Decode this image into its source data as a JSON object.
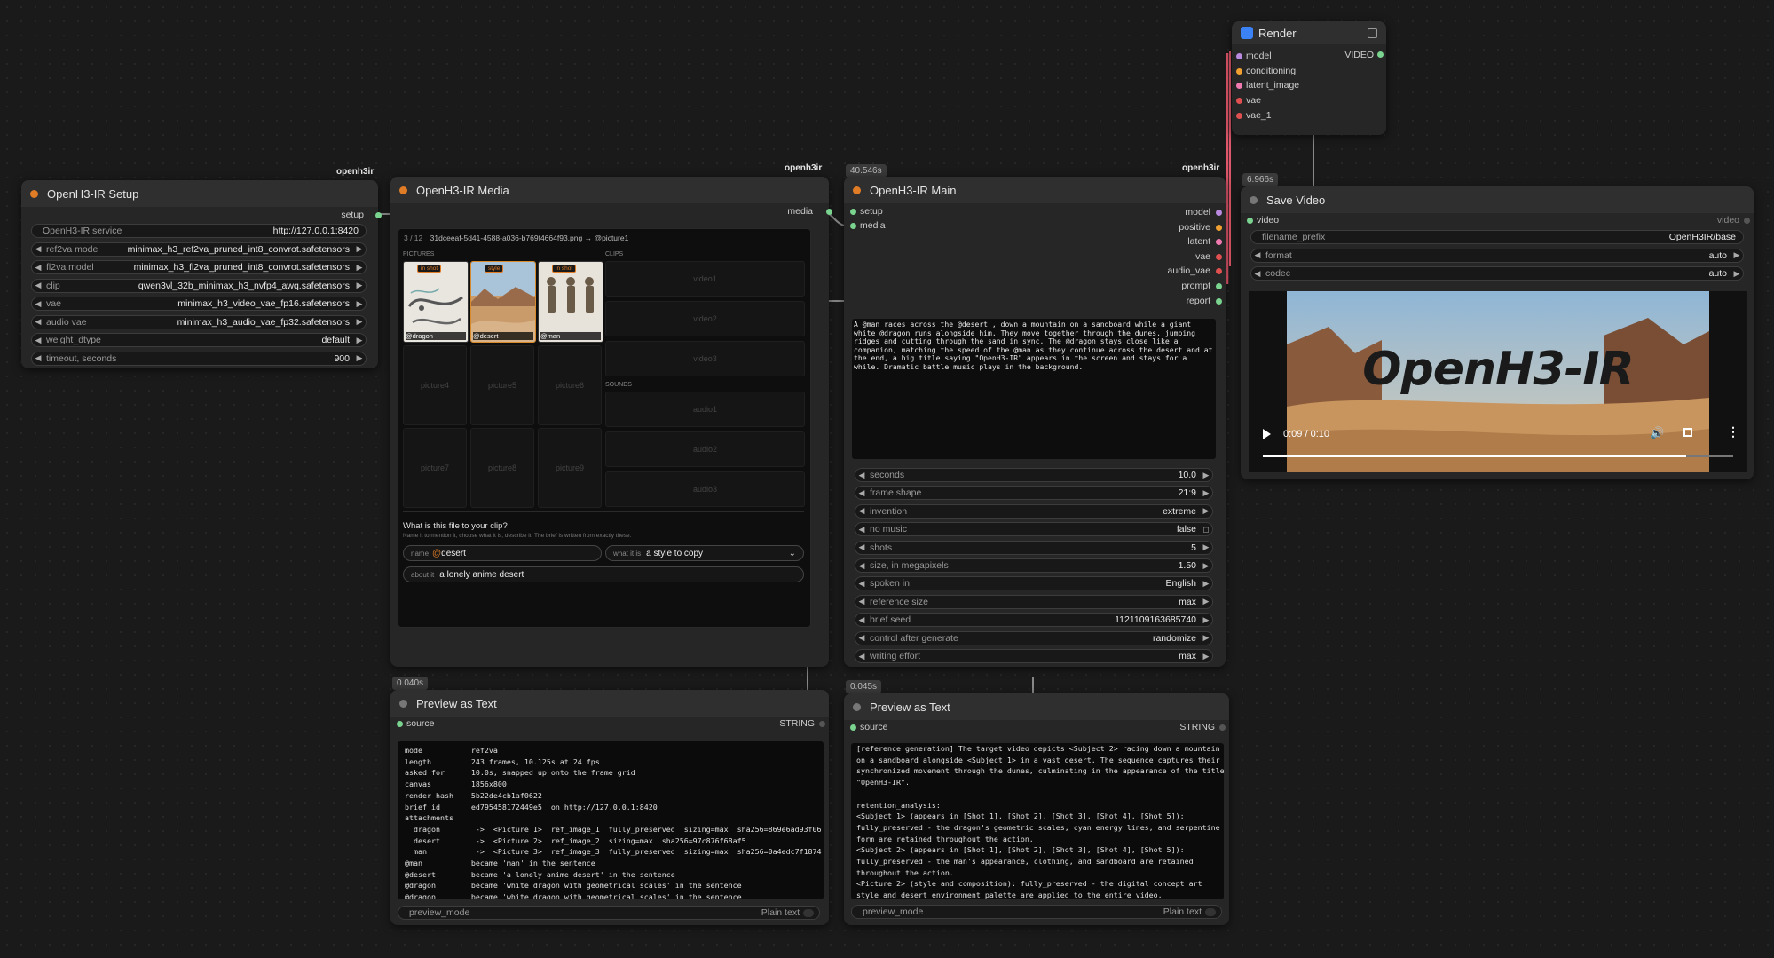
{
  "setup_node": {
    "tag": "openh3ir",
    "title": "OpenH3-IR Setup",
    "output": "setup",
    "widgets": [
      {
        "label": "OpenH3-IR service",
        "value": "http://127.0.0.1:8420"
      },
      {
        "label": "ref2va model",
        "value": "minimax_h3_ref2va_pruned_int8_convrot.safetensors"
      },
      {
        "label": "fl2va model",
        "value": "minimax_h3_fl2va_pruned_int8_convrot.safetensors"
      },
      {
        "label": "clip",
        "value": "qwen3vl_32b_minimax_h3_nvfp4_awq.safetensors"
      },
      {
        "label": "vae",
        "value": "minimax_h3_video_vae_fp16.safetensors"
      },
      {
        "label": "audio vae",
        "value": "minimax_h3_audio_vae_fp32.safetensors"
      },
      {
        "label": "weight_dtype",
        "value": "default"
      },
      {
        "label": "timeout, seconds",
        "value": "900"
      }
    ]
  },
  "media_node": {
    "tag": "openh3ir",
    "title": "OpenH3-IR Media",
    "output": "media",
    "counter": "3 / 12",
    "file": "31dceeaf-5d41-4588-a036-b769f4664f93.png → @picture1",
    "pictures_label": "PICTURES",
    "clips_label": "CLIPS",
    "sounds_label": "SOUNDS",
    "pictures": [
      {
        "badge": "in shot",
        "caption": "@dragon"
      },
      {
        "badge": "style",
        "caption": "@desert"
      },
      {
        "badge": "in shot",
        "caption": "@man"
      }
    ],
    "empty_pictures": [
      "picture4",
      "picture5",
      "picture6",
      "picture7",
      "picture8",
      "picture9"
    ],
    "clips": [
      "video1",
      "video2",
      "video3"
    ],
    "sounds": [
      "audio1",
      "audio2",
      "audio3"
    ],
    "question": "What is this file to your clip?",
    "hint": "Name it to mention it, choose what it is, describe it. The brief is written from exactly these.",
    "name_label": "name",
    "name_value": "desert",
    "what_label": "what it is",
    "what_value": "a style to copy",
    "about_label": "about it",
    "about_value": "a lonely anime desert"
  },
  "main_node": {
    "tag": "openh3ir",
    "timer": "40.546s",
    "title": "OpenH3-IR Main",
    "inputs": [
      "setup",
      "media"
    ],
    "outputs": [
      "model",
      "positive",
      "latent",
      "vae",
      "audio_vae",
      "prompt",
      "report"
    ],
    "prompt": "A @man races across the @desert , down a mountain on a sandboard while a giant white @dragon runs alongside him. They move together through the dunes, jumping ridges and cutting through the sand in sync. The @dragon stays close like a companion, matching the speed of the @man as they continue across the desert and at the end, a big title saying \"OpenH3-IR\" appears in the screen and stays for a while. Dramatic battle music plays in the background.",
    "widgets": [
      {
        "label": "seconds",
        "value": "10.0"
      },
      {
        "label": "frame shape",
        "value": "21:9"
      },
      {
        "label": "invention",
        "value": "extreme"
      },
      {
        "label": "no music",
        "value": "false"
      },
      {
        "label": "shots",
        "value": "5"
      },
      {
        "label": "size, in megapixels",
        "value": "1.50"
      },
      {
        "label": "spoken in",
        "value": "English"
      },
      {
        "label": "reference size",
        "value": "max"
      },
      {
        "label": "brief seed",
        "value": "1121109163685740"
      },
      {
        "label": "control after generate",
        "value": "randomize"
      },
      {
        "label": "writing effort",
        "value": "max"
      }
    ]
  },
  "render_node": {
    "title": "Render",
    "inputs": [
      "model",
      "conditioning",
      "latent_image",
      "vae",
      "vae_1"
    ],
    "output": "VIDEO"
  },
  "save_node": {
    "timer": "6.966s",
    "title": "Save Video",
    "input": "video",
    "output": "video",
    "widgets": [
      {
        "label": "filename_prefix",
        "value": "OpenH3IR/base"
      },
      {
        "label": "format",
        "value": "auto"
      },
      {
        "label": "codec",
        "value": "auto"
      }
    ],
    "video_title": "OpenH3-IR",
    "time": "0:09 / 0:10",
    "progress": 0.9
  },
  "preview1": {
    "timer": "0.040s",
    "title": "Preview as Text",
    "input": "source",
    "type": "STRING",
    "mode_label": "preview_mode",
    "mode_value": "Plain text",
    "text": "mode           ref2va\nlength         243 frames, 10.125s at 24 fps\nasked for      10.0s, snapped up onto the frame grid\ncanvas         1856x800\nrender hash    5b22de4cb1af0622\nbrief id       ed795458172449e5  on http://127.0.0.1:8420\nattachments\n  dragon        ->  <Picture 1>  ref_image_1  fully_preserved  sizing=max  sha256=869e6ad93f06\n  desert        ->  <Picture 2>  ref_image_2  sizing=max  sha256=97c876f68af5\n  man           ->  <Picture 3>  ref_image_3  fully_preserved  sizing=max  sha256=0a4edc7f1874\n@man           became 'man' in the sentence\n@desert        became 'a lonely anime desert' in the sentence\n@dragon        became 'white dragon with geometrical scales' in the sentence\n@dragon        became 'white dragon with geometrical scales' in the sentence"
  },
  "preview2": {
    "timer": "0.045s",
    "title": "Preview as Text",
    "input": "source",
    "type": "STRING",
    "mode_label": "preview_mode",
    "mode_value": "Plain text",
    "text": "[reference generation] The target video depicts <Subject 2> racing down a mountain\non a sandboard alongside <Subject 1> in a vast desert. The sequence captures their\nsynchronized movement through the dunes, culminating in the appearance of the title\n\"OpenH3-IR\".\n\nretention_analysis:\n<Subject 1> (appears in [Shot 1], [Shot 2], [Shot 3], [Shot 4], [Shot 5]):\nfully_preserved - the dragon's geometric scales, cyan energy lines, and serpentine\nform are retained throughout the action.\n<Subject 2> (appears in [Shot 1], [Shot 2], [Shot 3], [Shot 4], [Shot 5]):\nfully_preserved - the man's appearance, clothing, and sandboard are retained\nthroughout the action.\n<Picture 2> (style and composition): fully_preserved - the digital concept art\nstyle and desert environment palette are applied to the entire video."
  }
}
